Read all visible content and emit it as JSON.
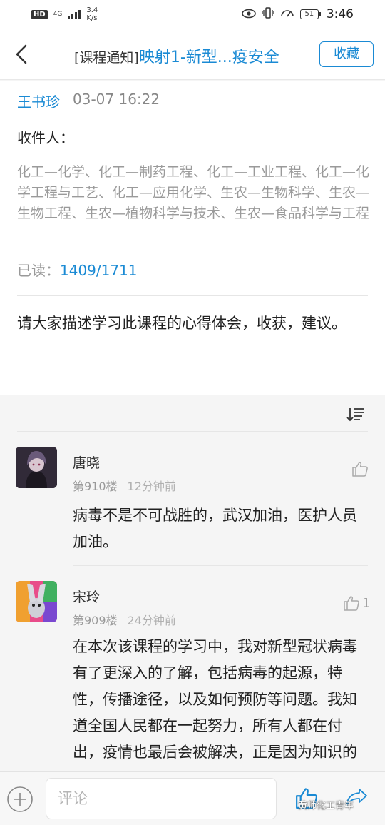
{
  "status_bar": {
    "hd": "HD",
    "net_type": "4G",
    "speed_value": "3.4",
    "speed_unit": "K/s",
    "battery": "51",
    "time": "3:46"
  },
  "nav": {
    "tag": "[课程通知]",
    "title": "映射1-新型...疫安全",
    "favorite_label": "收藏"
  },
  "notice": {
    "author": "王书珍",
    "time": "03-07 16:22",
    "recipients_label": "收件人：",
    "recipients": "化工—化学、化工—制药工程、化工—工业工程、化工—化学工程与工艺、化工—应用化学、生农—生物科学、生农—生物工程、生农—植物科学与技术、生农—食品科学与工程",
    "read_label": "已读：",
    "read_count": "1409/1711",
    "body": "请大家描述学习此课程的心得体会，收获，建议。"
  },
  "comments": [
    {
      "name": "唐晓",
      "floor": "第910楼",
      "ago": "12分钟前",
      "text": "病毒不是不可战胜的，武汉加油，医护人员加油。",
      "likes": ""
    },
    {
      "name": "宋玲",
      "floor": "第909楼",
      "ago": "24分钟前",
      "text": "在本次该课程的学习中，我对新型冠状病毒有了更深入的了解，包括病毒的起源，特性，传播途径，以及如何预防等问题。我知道全国人民都在一起努力，所有人都在付出，疫情也最后会被解决，正是因为知识的护撑",
      "likes": "1"
    }
  ],
  "bottom_bar": {
    "comment_placeholder": "评论"
  },
  "watermark": "黄师化工青年",
  "colors": {
    "accent": "#1a8ad4",
    "muted_text": "#999999",
    "background": "#f5f5f5"
  },
  "icons": [
    "back-arrow-icon",
    "sort-icon",
    "thumb-up-icon",
    "plus-icon",
    "share-icon",
    "eye-icon",
    "vibrate-icon",
    "speedometer-icon"
  ]
}
